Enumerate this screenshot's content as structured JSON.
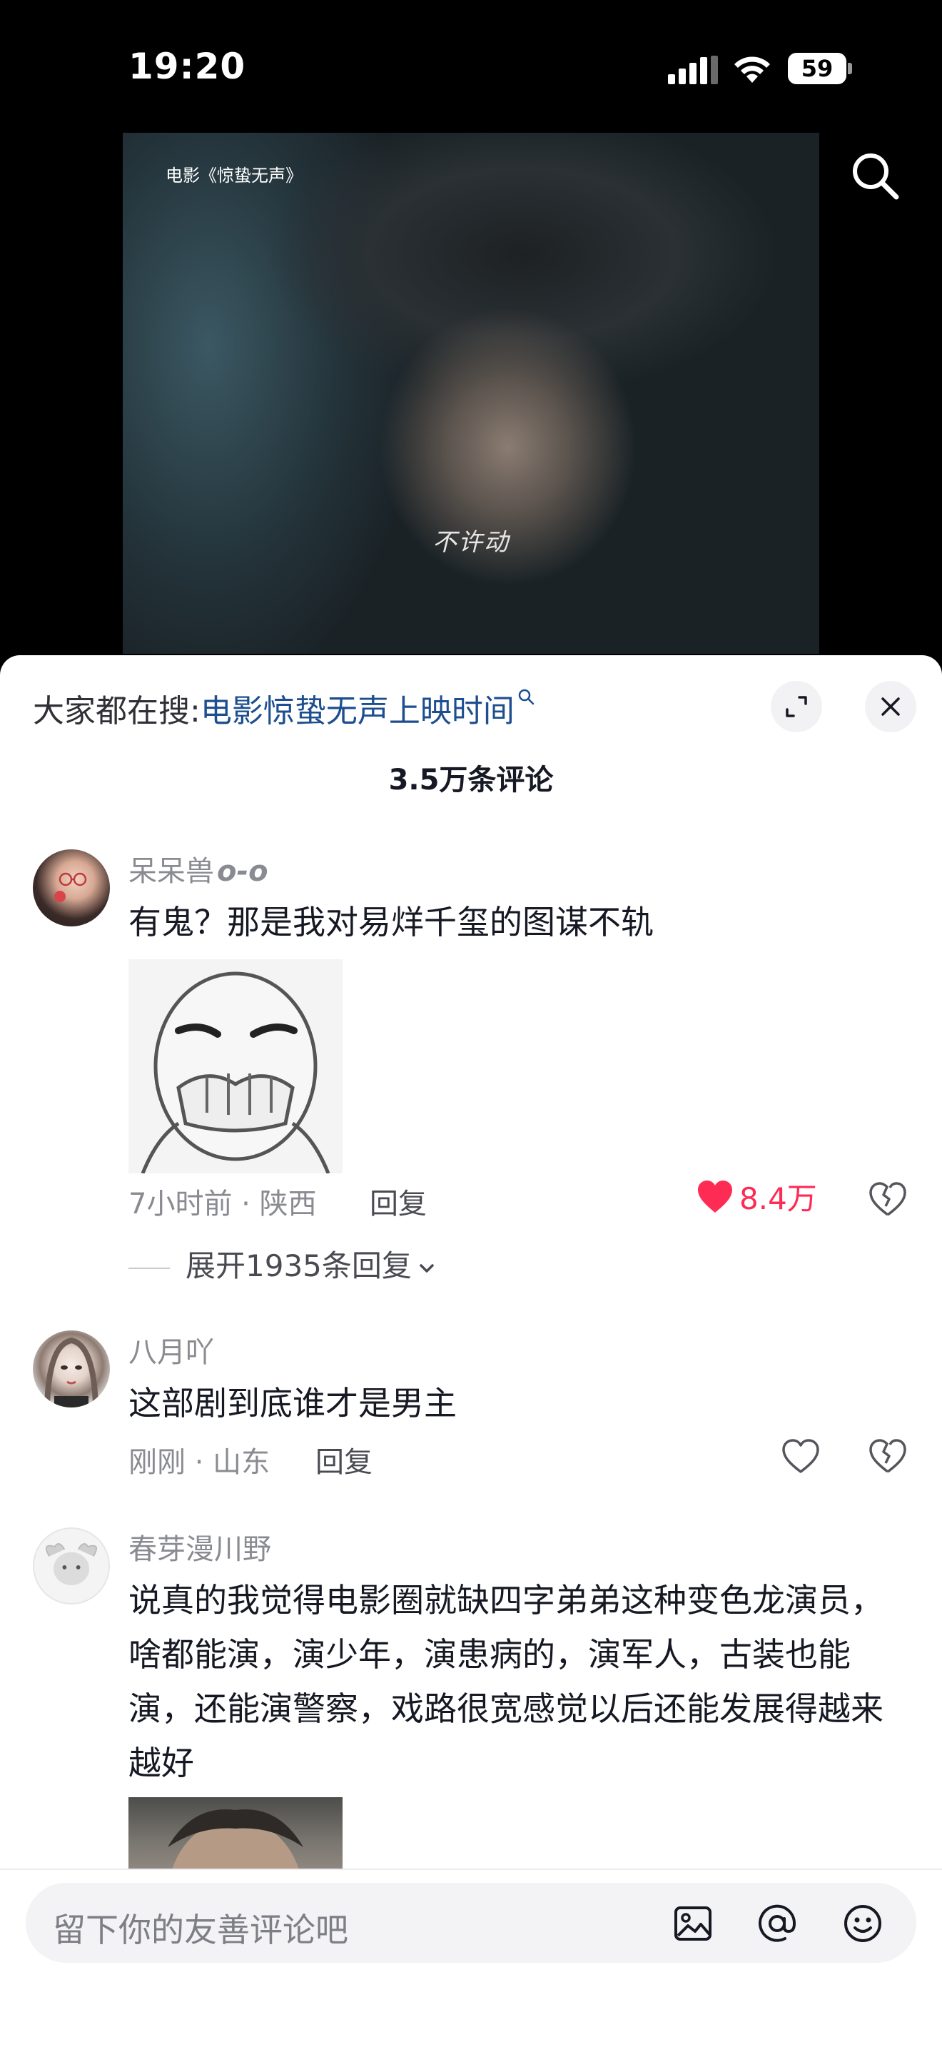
{
  "status_bar": {
    "time": "19:20",
    "battery": "59"
  },
  "video": {
    "title": "电影《惊蛰无声》",
    "subtitle": "不许动"
  },
  "sheet": {
    "hot_search_prefix": "大家都在搜:",
    "hot_search_link": "电影惊蛰无声上映时间",
    "comment_count": "3.5万条评论"
  },
  "comments": [
    {
      "username": "呆呆兽",
      "username_suffix": "o-o",
      "text": "有鬼？那是我对易烊千玺的图谋不轨",
      "meta": "7小时前 · 陕西",
      "reply": "回复",
      "likes": "8.4万",
      "expand": "展开1935条回复"
    },
    {
      "username": "八月吖",
      "text": "这部剧到底谁才是男主",
      "meta": "刚刚 · 山东",
      "reply": "回复"
    },
    {
      "username": "春芽漫川野",
      "text": "说真的我觉得电影圈就缺四字弟弟这种变色龙演员，啥都能演，演少年，演患病的，演军人，古装也能演，还能演警察，戏路很宽感觉以后还能发展得越来越好"
    }
  ],
  "input": {
    "placeholder": "留下你的友善评论吧"
  },
  "colors": {
    "accent": "#fe2c55",
    "link": "#1d4e8f"
  }
}
